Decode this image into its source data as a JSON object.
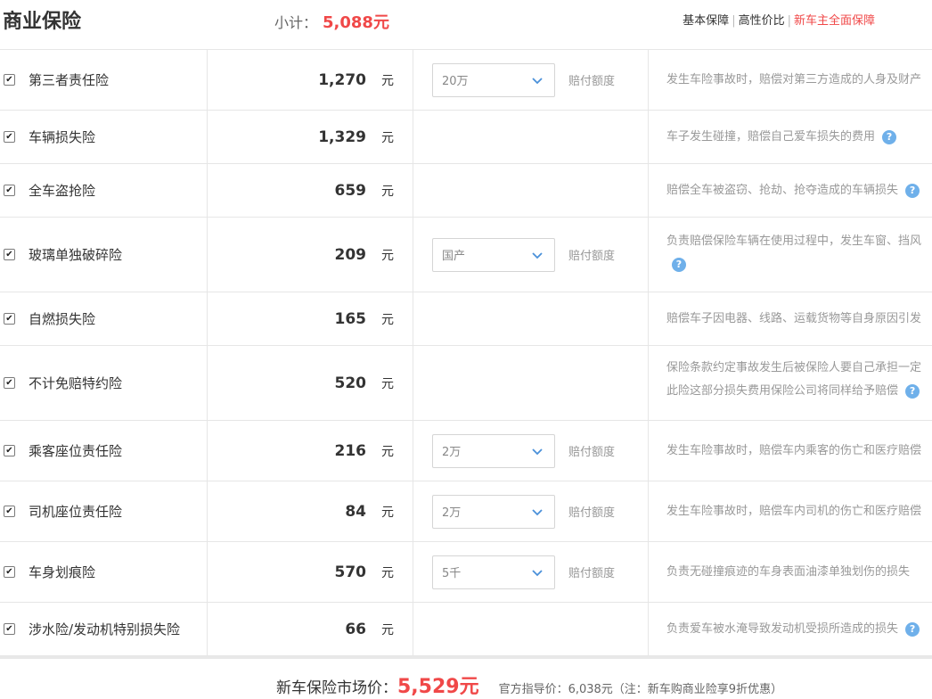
{
  "header": {
    "title": "商业保险",
    "subtotal_label": "小计：",
    "subtotal_value": "5,088元",
    "plans": [
      "基本保障",
      "高性价比",
      "新车主全面保障"
    ]
  },
  "rows": [
    {
      "name": "第三者责任险",
      "price": "1,270",
      "unit": "元",
      "select": "20万",
      "option_label": "赔付额度",
      "desc": "发生车险事故时，赔偿对第三方造成的人身及财产"
    },
    {
      "name": "车辆损失险",
      "price": "1,329",
      "unit": "元",
      "desc": "车子发生碰撞，赔偿自己爱车损失的费用",
      "help": "?"
    },
    {
      "name": "全车盗抢险",
      "price": "659",
      "unit": "元",
      "desc": "赔偿全车被盗窃、抢劫、抢夺造成的车辆损失",
      "help": "?"
    },
    {
      "name": "玻璃单独破碎险",
      "price": "209",
      "unit": "元",
      "select": "国产",
      "option_label": "赔付额度",
      "desc": "负责赔偿保险车辆在使用过程中，发生车窗、挡风",
      "help": "?"
    },
    {
      "name": "自燃损失险",
      "price": "165",
      "unit": "元",
      "desc": "赔偿车子因电器、线路、运载货物等自身原因引发"
    },
    {
      "name": "不计免赔特约险",
      "price": "520",
      "unit": "元",
      "desc": "保险条款约定事故发生后被保险人要自己承担一定",
      "desc2": "此险这部分损失费用保险公司将同样给予赔偿",
      "help": "?"
    },
    {
      "name": "乘客座位责任险",
      "price": "216",
      "unit": "元",
      "select": "2万",
      "option_label": "赔付额度",
      "desc": "发生车险事故时，赔偿车内乘客的伤亡和医疗赔偿"
    },
    {
      "name": "司机座位责任险",
      "price": "84",
      "unit": "元",
      "select": "2万",
      "option_label": "赔付额度",
      "desc": "发生车险事故时，赔偿车内司机的伤亡和医疗赔偿"
    },
    {
      "name": "车身划痕险",
      "price": "570",
      "unit": "元",
      "select": "5千",
      "option_label": "赔付额度",
      "desc": "负责无碰撞痕迹的车身表面油漆单独划伤的损失"
    },
    {
      "name": "涉水险/发动机特别损失险",
      "price": "66",
      "unit": "元",
      "desc": "负责爱车被水淹导致发动机受损所造成的损失",
      "help": "?"
    }
  ],
  "footer": {
    "market_label": "新车保险市场价：",
    "market_value": "5,529元",
    "guide_note": "官方指导价：6,038元（注：新车购商业险享9折优惠）"
  },
  "colors": {
    "accent": "#f04848",
    "help": "#6fb0ea"
  }
}
